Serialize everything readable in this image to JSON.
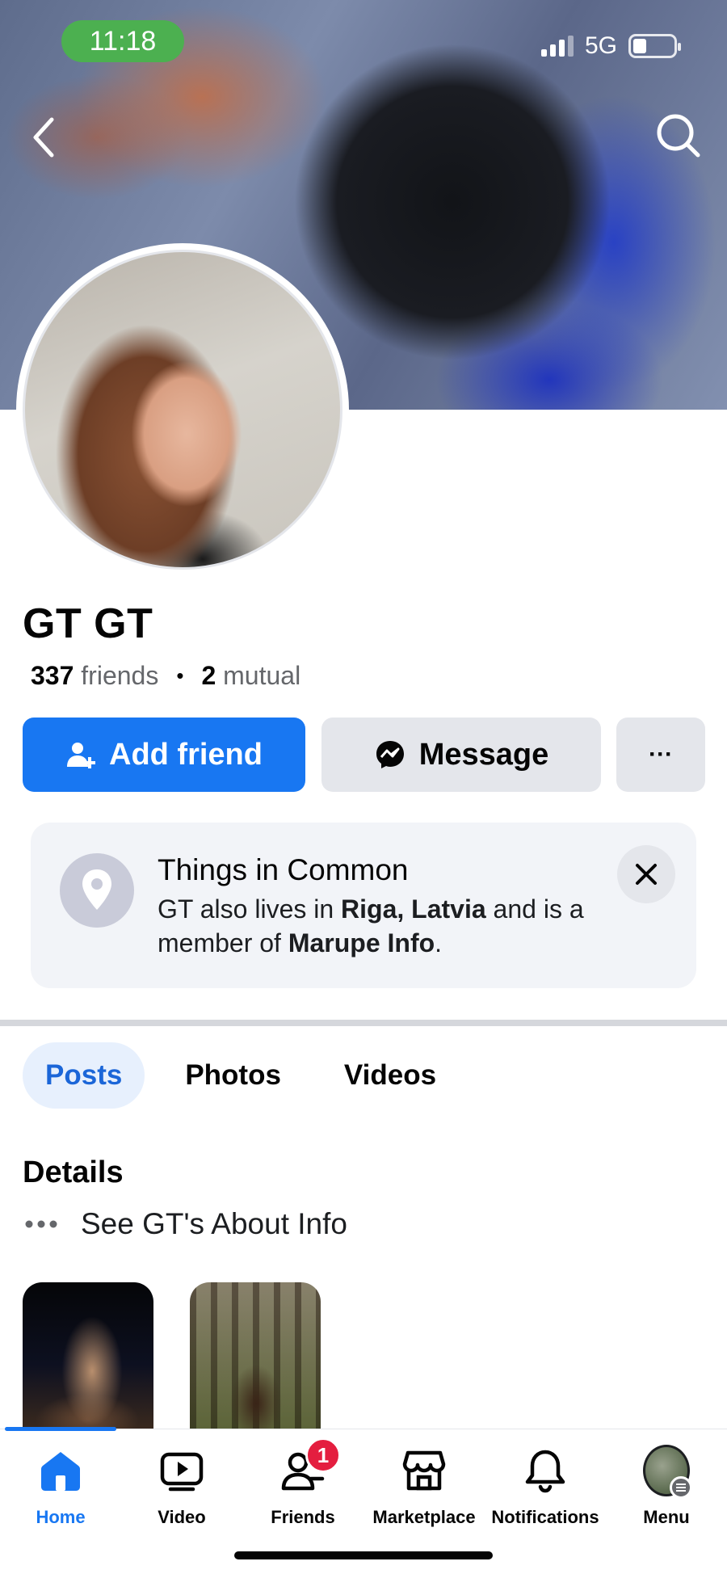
{
  "status_bar": {
    "time": "11:18",
    "network": "5G"
  },
  "profile": {
    "name": "GT GT",
    "friends_count": "337",
    "friends_label": "friends",
    "mutual_count": "2",
    "mutual_label": "mutual"
  },
  "actions": {
    "add_friend": "Add friend",
    "message": "Message",
    "more": "···"
  },
  "things_in_common": {
    "title": "Things in Common",
    "text_1": "GT also lives in ",
    "place": "Riga, Latvia",
    "text_2": " and is a member of ",
    "group": "Marupe Info",
    "text_3": "."
  },
  "tabs": [
    {
      "label": "Posts",
      "active": true
    },
    {
      "label": "Photos",
      "active": false
    },
    {
      "label": "Videos",
      "active": false
    }
  ],
  "details": {
    "title": "Details",
    "about_link": "See GT's About Info"
  },
  "bottom_nav": [
    {
      "label": "Home",
      "icon": "home-icon",
      "active": true
    },
    {
      "label": "Video",
      "icon": "video-icon",
      "active": false
    },
    {
      "label": "Friends",
      "icon": "friends-icon",
      "badge": "1",
      "active": false
    },
    {
      "label": "Marketplace",
      "icon": "marketplace-icon",
      "active": false
    },
    {
      "label": "Notifications",
      "icon": "bell-icon",
      "active": false
    },
    {
      "label": "Menu",
      "icon": "menu-avatar",
      "active": false
    }
  ],
  "colors": {
    "accent": "#1877f2",
    "badge": "#e41e3f",
    "status_time_bg": "#4cb050"
  }
}
